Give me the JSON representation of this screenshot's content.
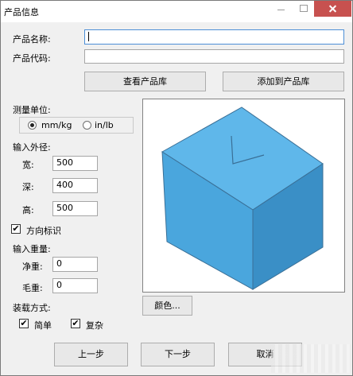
{
  "window": {
    "title": "产品信息"
  },
  "product": {
    "name_label": "产品名称:",
    "name_value": "",
    "code_label": "产品代码:",
    "code_value": ""
  },
  "actions": {
    "view_library": "查看产品库",
    "add_to_library": "添加到产品库"
  },
  "units": {
    "label": "测量单位:",
    "options": [
      "mm/kg",
      "in/lb"
    ],
    "selected": "mm/kg"
  },
  "dimensions": {
    "label": "输入外径:",
    "width_label": "宽:",
    "width_value": "500",
    "depth_label": "深:",
    "depth_value": "400",
    "height_label": "高:",
    "height_value": "500"
  },
  "orientation": {
    "label": "方向标识",
    "checked": true
  },
  "weight": {
    "label": "输入重量:",
    "net_label": "净重:",
    "net_value": "0",
    "gross_label": "毛重:",
    "gross_value": "0"
  },
  "color_button": "颜色...",
  "loading": {
    "label": "装载方式:",
    "simple_label": "简单",
    "simple_checked": true,
    "complex_label": "复杂",
    "complex_checked": true
  },
  "nav": {
    "prev": "上一步",
    "next": "下一步",
    "cancel": "取消"
  },
  "colors": {
    "box_top": "#5fb7ea",
    "box_front": "#4aa6dd",
    "box_side": "#3a8fc6",
    "box_edge": "#3a6f96",
    "close_button": "#c7514f"
  }
}
